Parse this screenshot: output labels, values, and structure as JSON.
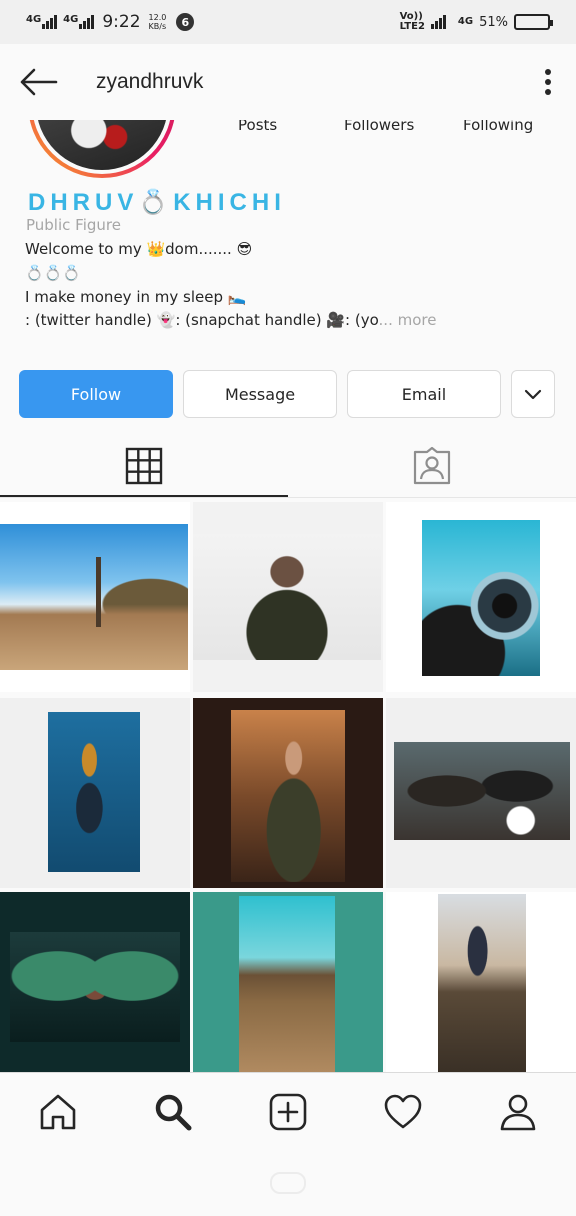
{
  "status_bar": {
    "network_1": "4G",
    "network_2": "4G",
    "time": "9:22",
    "speed_value": "12.0",
    "speed_unit": "KB/s",
    "notification_count": "6",
    "volte_1": "Vo))",
    "volte_2": "LTE2",
    "right_network": "4G",
    "battery_percent": "51%",
    "battery_level": 0.51
  },
  "header": {
    "username": "zyandhruvk",
    "back_icon": "arrow-left-icon",
    "more_icon": "vertical-dots-icon"
  },
  "profile": {
    "stats": {
      "posts_label": "Posts",
      "followers_label": "Followers",
      "following_label": "Following"
    },
    "display_name": "DHRUV💍KHICHI",
    "category": "Public Figure",
    "bio": {
      "line1": "Welcome to my 👑dom....... 😎",
      "line2": "💍💍💍",
      "line3": "I make money in my sleep 🛌",
      "line4": ": (twitter handle) 👻: (snapchat handle) 🎥: (yo",
      "more": "... more"
    }
  },
  "actions": {
    "follow": "Follow",
    "message": "Message",
    "email": "Email",
    "expand_icon": "chevron-down-icon"
  },
  "tabs": {
    "grid_icon": "grid-icon",
    "tagged_icon": "tagged-person-icon",
    "active": "grid"
  },
  "posts": [
    {
      "subject": "tree in desert landscape"
    },
    {
      "subject": "man portrait light background"
    },
    {
      "subject": "circular lens with sky"
    },
    {
      "subject": "man against blue wall"
    },
    {
      "subject": "man in jacket at dusk"
    },
    {
      "subject": "people in car"
    },
    {
      "subject": "man with wings mural"
    },
    {
      "subject": "person sitting on rocks teal sky"
    },
    {
      "subject": "person on cliff sunset"
    }
  ],
  "bottom_nav": {
    "items": [
      "home-icon",
      "search-icon",
      "add-post-icon",
      "activity-heart-icon",
      "profile-icon"
    ],
    "active": "search-icon"
  },
  "colors": {
    "accent": "#3897f0",
    "name_color": "#39b5e4",
    "muted": "#a6a6a6",
    "text": "#262626"
  }
}
